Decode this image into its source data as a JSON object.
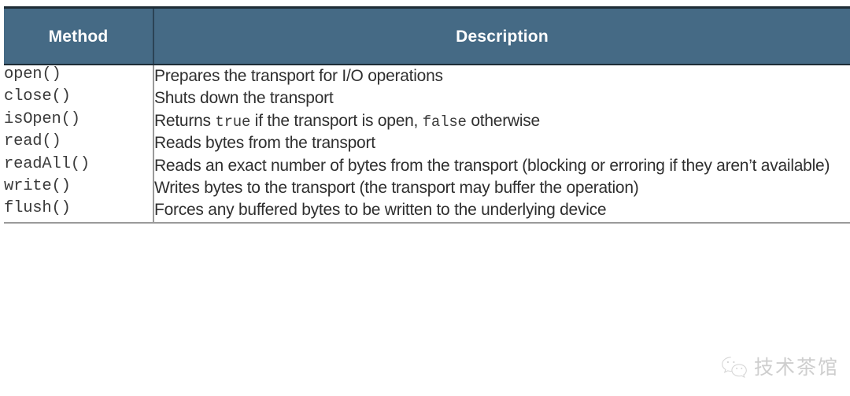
{
  "table": {
    "columns": [
      {
        "key": "method",
        "label": "Method"
      },
      {
        "key": "description",
        "label": "Description"
      }
    ],
    "header_background": "#456a85",
    "header_text_color": "#ffffff",
    "divider_color": "#9a9a9a",
    "rows": [
      {
        "method": "open()",
        "description_parts": [
          {
            "type": "text",
            "value": "Prepares the transport for I/O operations"
          }
        ],
        "description_plain": "Prepares the transport for I/O operations"
      },
      {
        "method": "close()",
        "description_parts": [
          {
            "type": "text",
            "value": "Shuts down the transport"
          }
        ],
        "description_plain": "Shuts down the transport"
      },
      {
        "method": "isOpen()",
        "description_parts": [
          {
            "type": "text",
            "value": "Returns "
          },
          {
            "type": "code",
            "value": "true"
          },
          {
            "type": "text",
            "value": " if the transport is open, "
          },
          {
            "type": "code",
            "value": "false"
          },
          {
            "type": "text",
            "value": " otherwise"
          }
        ],
        "description_plain": "Returns true if the transport is open, false otherwise"
      },
      {
        "method": "read()",
        "description_parts": [
          {
            "type": "text",
            "value": "Reads bytes from the transport"
          }
        ],
        "description_plain": "Reads bytes from the transport"
      },
      {
        "method": "readAll()",
        "description_parts": [
          {
            "type": "text",
            "value": "Reads an exact number of bytes from the transport (blocking or erroring if they aren’t available)"
          }
        ],
        "description_plain": "Reads an exact number of bytes from the transport (blocking or erroring if they aren’t available)"
      },
      {
        "method": "write()",
        "description_parts": [
          {
            "type": "text",
            "value": "Writes bytes to the transport (the transport may buffer the operation)"
          }
        ],
        "description_plain": "Writes bytes to the transport (the transport may buffer the operation)"
      },
      {
        "method": "flush()",
        "description_parts": [
          {
            "type": "text",
            "value": "Forces any buffered bytes to be written to the underlying device"
          }
        ],
        "description_plain": "Forces any buffered bytes to be written to the underlying device"
      }
    ]
  },
  "watermark": {
    "icon": "wechat-icon",
    "text": "技术茶馆",
    "color": "#c9c9c9"
  }
}
